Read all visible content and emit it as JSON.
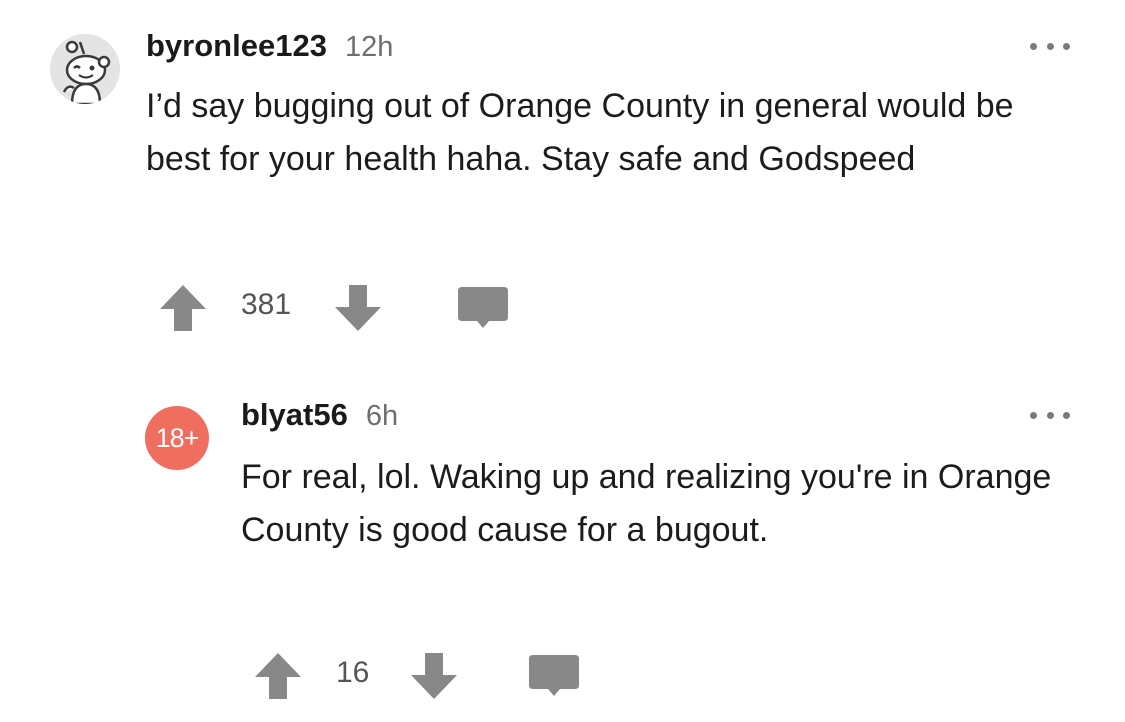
{
  "comments": [
    {
      "avatar_icon": "snoo-avatar-icon",
      "username": "byronlee123",
      "age": "12h",
      "text": "I’d say bugging out of Orange County in general would be best for your health haha. Stay safe and Godspeed",
      "score": "381"
    },
    {
      "avatar_icon": "nsfw-avatar-icon",
      "avatar_label": "18+",
      "avatar_color": "#ef6e60",
      "username": "blyat56",
      "age": "6h",
      "text": "For real, lol. Waking up and realizing you're in Orange County is good cause for a bugout.",
      "score": "16"
    }
  ],
  "icons": {
    "more": "more-options-icon",
    "upvote": "upvote-arrow-icon",
    "downvote": "downvote-arrow-icon",
    "reply": "reply-speech-bubble-icon"
  },
  "colors": {
    "icon_gray": "#888888",
    "text": "#1c1c1c",
    "meta_gray": "#6f6f6f"
  }
}
